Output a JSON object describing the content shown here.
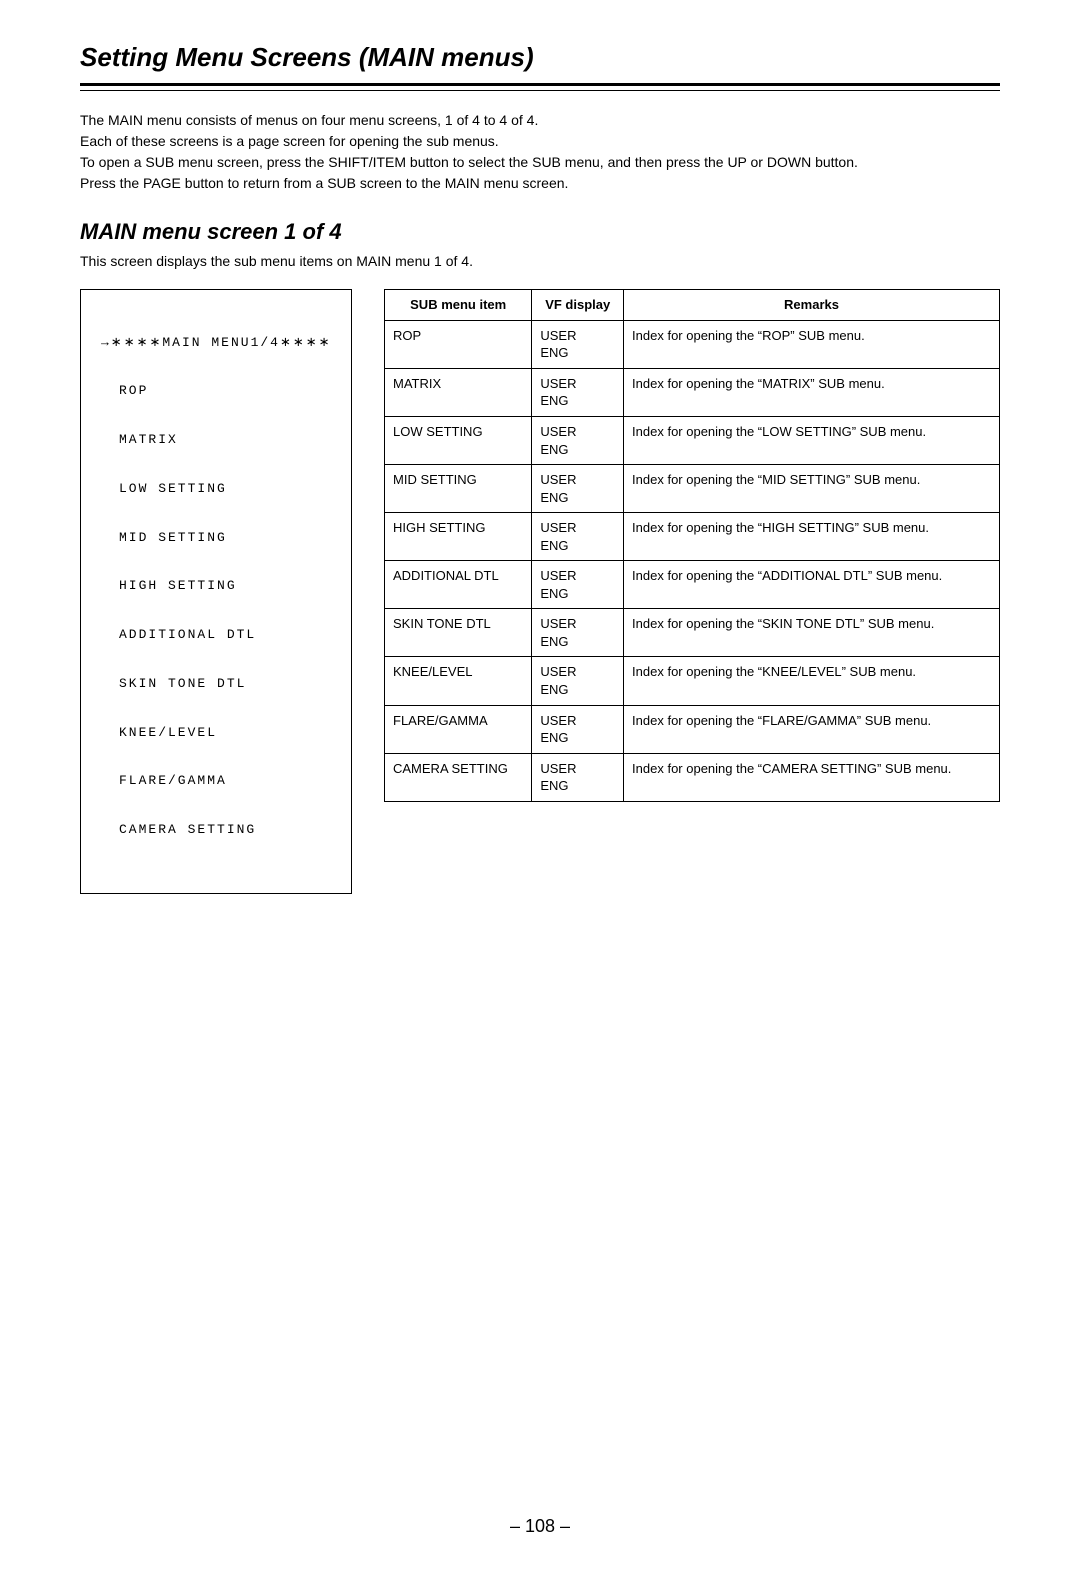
{
  "page_title": "Setting Menu Screens (MAIN menus)",
  "intro": [
    "The MAIN menu consists of menus on four menu screens, 1 of 4 to 4 of 4.",
    "Each of these screens is a page screen for opening the sub menus.",
    "To open a SUB menu screen, press the SHIFT/ITEM button to select the SUB menu, and then press the UP or DOWN button.",
    "Press the PAGE button to return from a SUB screen to the MAIN menu screen."
  ],
  "section_heading": "MAIN menu screen 1 of 4",
  "section_caption": "This screen displays the sub menu items on MAIN menu 1 of 4.",
  "menu_box": {
    "header": "→∗∗∗∗MAIN MENU1/4∗∗∗∗",
    "items": [
      "ROP",
      "MATRIX",
      "LOW SETTING",
      "MID SETTING",
      "HIGH SETTING",
      "ADDITIONAL DTL",
      "SKIN TONE DTL",
      "KNEE/LEVEL",
      "FLARE/GAMMA",
      "CAMERA SETTING"
    ]
  },
  "table": {
    "headers": {
      "col1": "SUB menu item",
      "col2": "VF display",
      "col3": "Remarks"
    },
    "rows": [
      {
        "item": "ROP",
        "vf": "USER ENG",
        "remarks": "Index for opening the “ROP” SUB menu."
      },
      {
        "item": "MATRIX",
        "vf": "USER ENG",
        "remarks": "Index for opening the “MATRIX” SUB menu."
      },
      {
        "item": "LOW SETTING",
        "vf": "USER ENG",
        "remarks": "Index for opening the “LOW SETTING” SUB menu."
      },
      {
        "item": "MID SETTING",
        "vf": "USER ENG",
        "remarks": "Index for opening the “MID SETTING” SUB menu."
      },
      {
        "item": "HIGH SETTING",
        "vf": "USER ENG",
        "remarks": "Index for opening the “HIGH SETTING” SUB menu."
      },
      {
        "item": "ADDITIONAL DTL",
        "vf": "USER ENG",
        "remarks": "Index for opening the “ADDITIONAL DTL” SUB menu."
      },
      {
        "item": "SKIN TONE DTL",
        "vf": "USER ENG",
        "remarks": "Index for opening the “SKIN TONE DTL” SUB menu."
      },
      {
        "item": "KNEE/LEVEL",
        "vf": "USER ENG",
        "remarks": "Index for opening the “KNEE/LEVEL” SUB menu."
      },
      {
        "item": "FLARE/GAMMA",
        "vf": "USER ENG",
        "remarks": "Index for opening the “FLARE/GAMMA” SUB menu."
      },
      {
        "item": "CAMERA SETTING",
        "vf": "USER ENG",
        "remarks": "Index for opening the “CAMERA SETTING” SUB menu."
      }
    ]
  },
  "page_number": "– 108 –"
}
